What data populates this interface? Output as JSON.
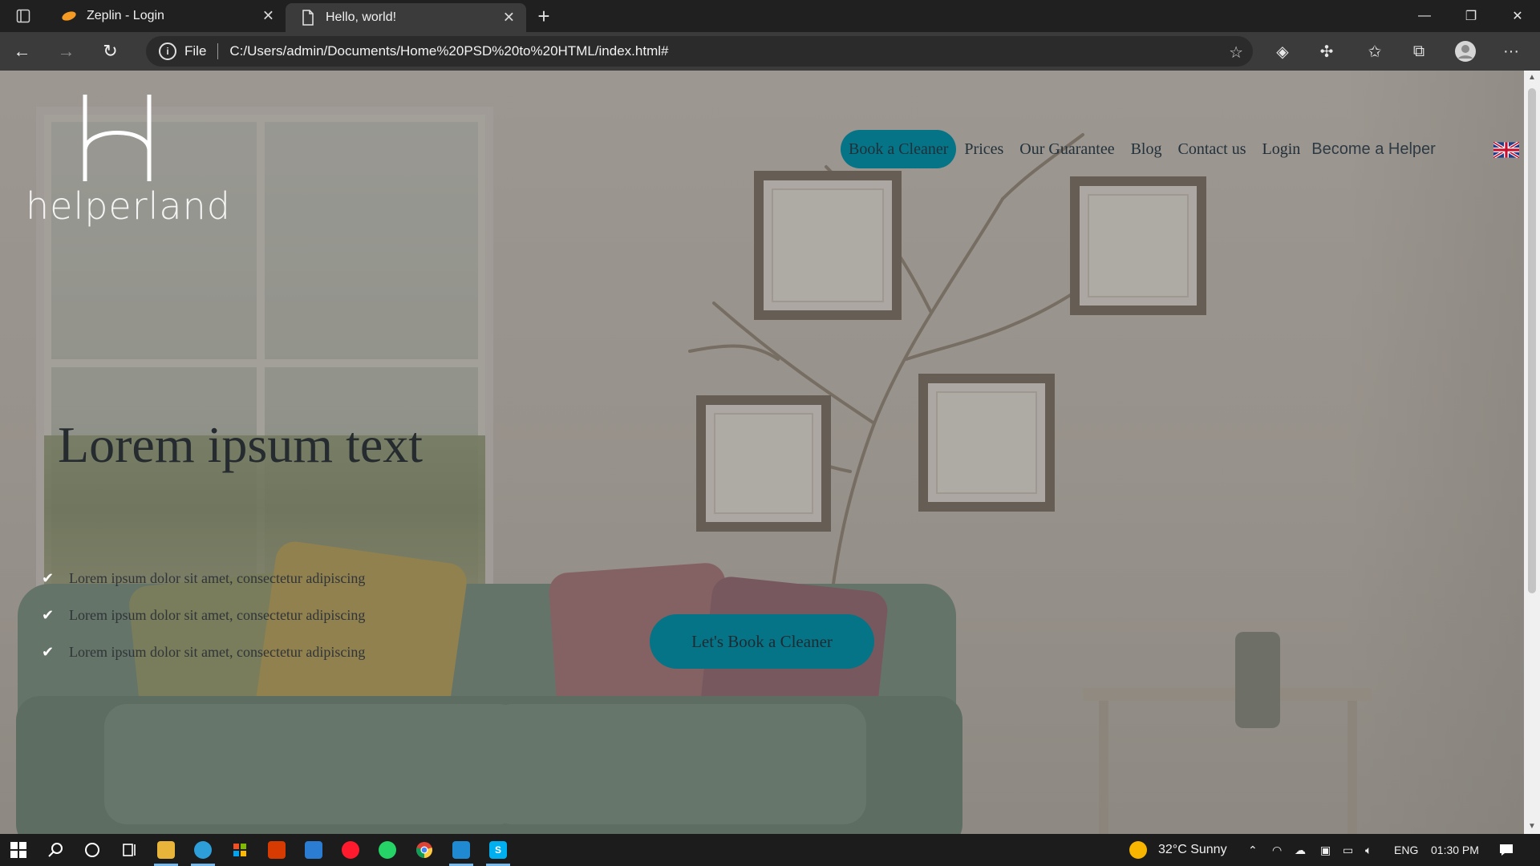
{
  "browser": {
    "tabs": [
      {
        "title": "Zeplin - Login",
        "icon": "zeplin-icon",
        "active": false
      },
      {
        "title": "Hello, world!",
        "icon": "page-icon",
        "active": true
      }
    ],
    "address": {
      "scheme_label": "File",
      "url": "C:/Users/admin/Documents/Home%20PSD%20to%20HTML/index.html#"
    }
  },
  "site": {
    "logo_text": "helperland",
    "nav": {
      "book": "Book a Cleaner",
      "items": [
        "Prices",
        "Our Guarantee",
        "Blog",
        "Contact us"
      ],
      "login": "Login",
      "helper": "Become a Helper",
      "language_icon": "uk-flag-icon"
    },
    "hero": {
      "title": "Lorem ipsum text",
      "bullets": [
        "Lorem ipsum dolor sit amet, consectetur adipiscing",
        "Lorem ipsum dolor sit amet, consectetur adipiscing",
        "Lorem ipsum dolor sit amet, consectetur adipiscing"
      ],
      "cta": "Let's Book a Cleaner"
    },
    "colors": {
      "accent": "#067487"
    }
  },
  "taskbar": {
    "weather": "32°C  Sunny",
    "language": "ENG",
    "time": "01:30 PM"
  }
}
